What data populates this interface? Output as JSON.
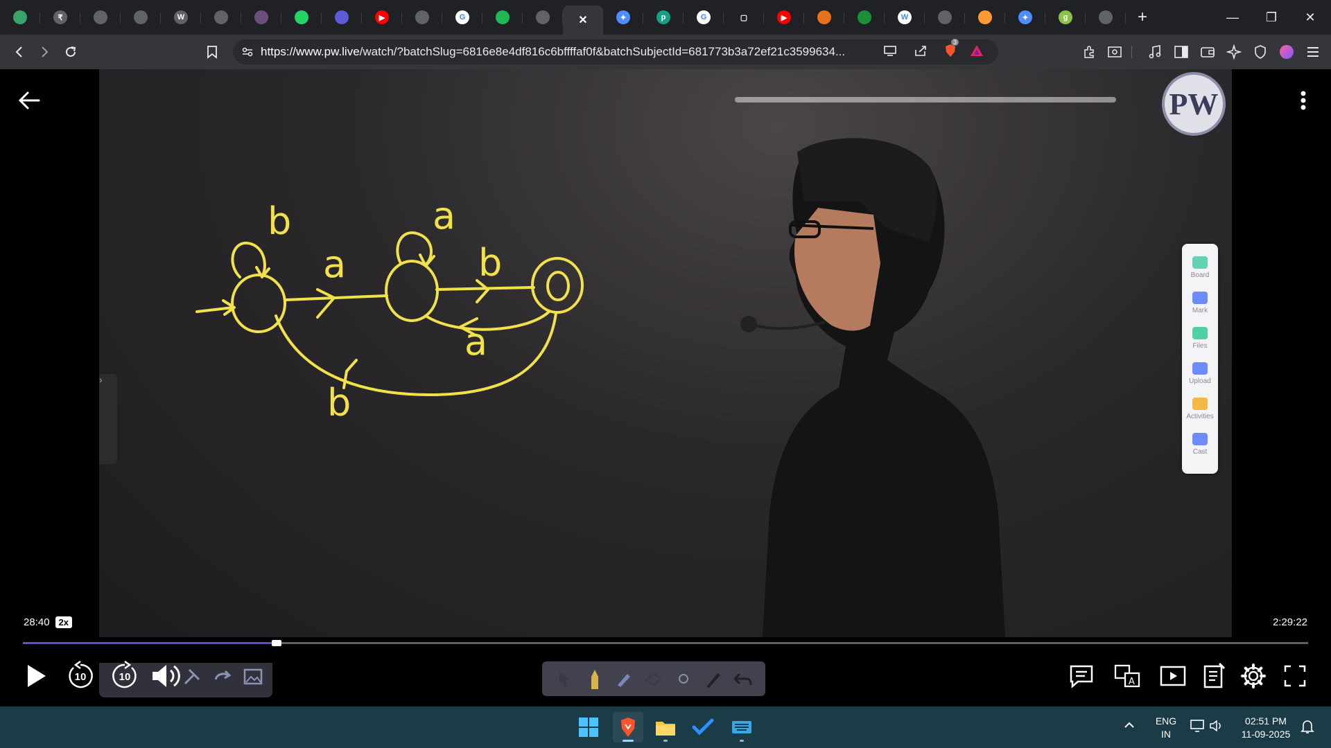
{
  "browser": {
    "tabs": [
      {
        "icon": "whatsapp-style-icon",
        "color": "#3aa36b",
        "glyph": ""
      },
      {
        "icon": "coin-icon",
        "color": "#5f6368",
        "glyph": "₹"
      },
      {
        "icon": "globe-icon",
        "color": "#5f6368",
        "glyph": ""
      },
      {
        "icon": "globe-icon",
        "color": "#5f6368",
        "glyph": ""
      },
      {
        "icon": "wordpress-icon",
        "color": "#5f6368",
        "glyph": "W"
      },
      {
        "icon": "globe-icon",
        "color": "#5f6368",
        "glyph": ""
      },
      {
        "icon": "globe-icon",
        "color": "#6b4f7a",
        "glyph": ""
      },
      {
        "icon": "whatsapp-icon",
        "color": "#25d366",
        "glyph": ""
      },
      {
        "icon": "bookmark-icon",
        "color": "#5b5bd6",
        "glyph": ""
      },
      {
        "icon": "youtube-icon",
        "color": "#ff0000",
        "glyph": "▶"
      },
      {
        "icon": "globe-icon",
        "color": "#5f6368",
        "glyph": ""
      },
      {
        "icon": "google-icon",
        "color": "#ffffff",
        "glyph": "G"
      },
      {
        "icon": "spotify-icon",
        "color": "#1db954",
        "glyph": ""
      },
      {
        "icon": "globe-icon",
        "color": "#5f6368",
        "glyph": ""
      },
      {
        "icon": "close-tab-icon",
        "color": "#35363a",
        "glyph": "✕",
        "active": true
      },
      {
        "icon": "gemini-icon",
        "color": "#4e8cff",
        "glyph": "✦"
      },
      {
        "icon": "app-icon",
        "color": "#16a085",
        "glyph": "p"
      },
      {
        "icon": "google-icon",
        "color": "#ffffff",
        "glyph": "G"
      },
      {
        "icon": "screen-icon",
        "color": "#202124",
        "glyph": "▢"
      },
      {
        "icon": "youtube-icon",
        "color": "#ff0000",
        "glyph": "▶"
      },
      {
        "icon": "app-icon",
        "color": "#e8711a",
        "glyph": ""
      },
      {
        "icon": "leetcode-icon",
        "color": "#1b8f3a",
        "glyph": ""
      },
      {
        "icon": "wikipedia-icon",
        "color": "#ffffff",
        "glyph": "W"
      },
      {
        "icon": "globe-icon",
        "color": "#5f6368",
        "glyph": ""
      },
      {
        "icon": "flag-india-icon",
        "color": "#ff9933",
        "glyph": ""
      },
      {
        "icon": "gemini-icon",
        "color": "#4e8cff",
        "glyph": "✦"
      },
      {
        "icon": "app-icon",
        "color": "#8bc34a",
        "glyph": "g"
      },
      {
        "icon": "globe-icon",
        "color": "#5f6368",
        "glyph": ""
      }
    ],
    "new_tab_label": "+",
    "url_host": "https://www.pw.live",
    "url_path": "/watch/?batchSlug=6816e8e4df816c6bffffaf0f&batchSubjectId=681773b3a72ef21c3599634...",
    "brave_shield_count": "3"
  },
  "player": {
    "current_time": "28:40",
    "speed": "2x",
    "total_time": "2:29:22",
    "progress_fraction": 0.196,
    "rewind_seconds": "10",
    "forward_seconds": "10",
    "logo_text": "PW",
    "accent_color": "#5a4fd8"
  },
  "board_panel": {
    "items": [
      {
        "label": "Board",
        "icon": "board-icon",
        "color": "#61d2b4"
      },
      {
        "label": "Mark",
        "icon": "pen-icon",
        "color": "#6d8bff"
      },
      {
        "label": "Files",
        "icon": "folder-icon",
        "color": "#4fd1a5"
      },
      {
        "label": "Upload",
        "icon": "camera-icon",
        "color": "#6d8bff"
      },
      {
        "label": "Activities",
        "icon": "lightbulb-icon",
        "color": "#f4b942"
      },
      {
        "label": "Cast",
        "icon": "cast-icon",
        "color": "#6d8bff"
      }
    ]
  },
  "whiteboard": {
    "labels": [
      "b",
      "a",
      "a",
      "b",
      "a",
      "b"
    ]
  },
  "taskbar": {
    "lang_top": "ENG",
    "lang_bottom": "IN",
    "time": "02:51 PM",
    "date": "11-09-2025"
  }
}
